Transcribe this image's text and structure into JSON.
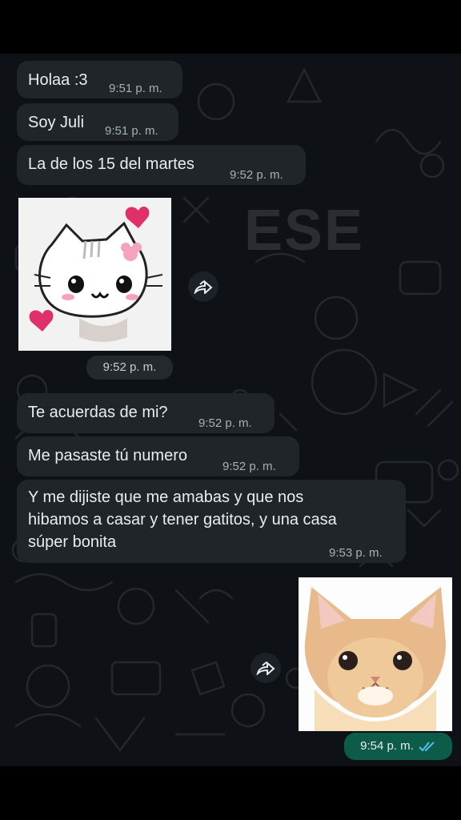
{
  "watermark": "ESE",
  "messages": [
    {
      "text": "Holaa :3",
      "time": "9:51 p. m."
    },
    {
      "text": "Soy Juli",
      "time": "9:51 p. m."
    },
    {
      "text": "La de los 15 del martes",
      "time": "9:52 p. m."
    },
    {
      "image": "cartoon white cat sticker with pink hearts",
      "time": "9:52 p. m."
    },
    {
      "text": "Te acuerdas de mi?",
      "time": "9:52 p. m."
    },
    {
      "text": "Me pasaste tú numero",
      "time": "9:52 p. m."
    },
    {
      "text": "Y me dijiste que me amabas y que nos\nhibamos a casar  y tener gatitos, y una casa\nsúper bonita",
      "time": "9:53 p. m."
    },
    {
      "image": "orange kitten photo",
      "time": "9:54 p. m.",
      "outgoing": true,
      "status": "read"
    }
  ],
  "icons": {
    "forward": "forward-icon",
    "read_receipt": "double-check-icon"
  },
  "colors": {
    "incoming_bubble": "#1f2529",
    "outgoing_bubble": "#0d5c4a",
    "read_tick": "#53bdeb",
    "background": "#0e1216"
  }
}
